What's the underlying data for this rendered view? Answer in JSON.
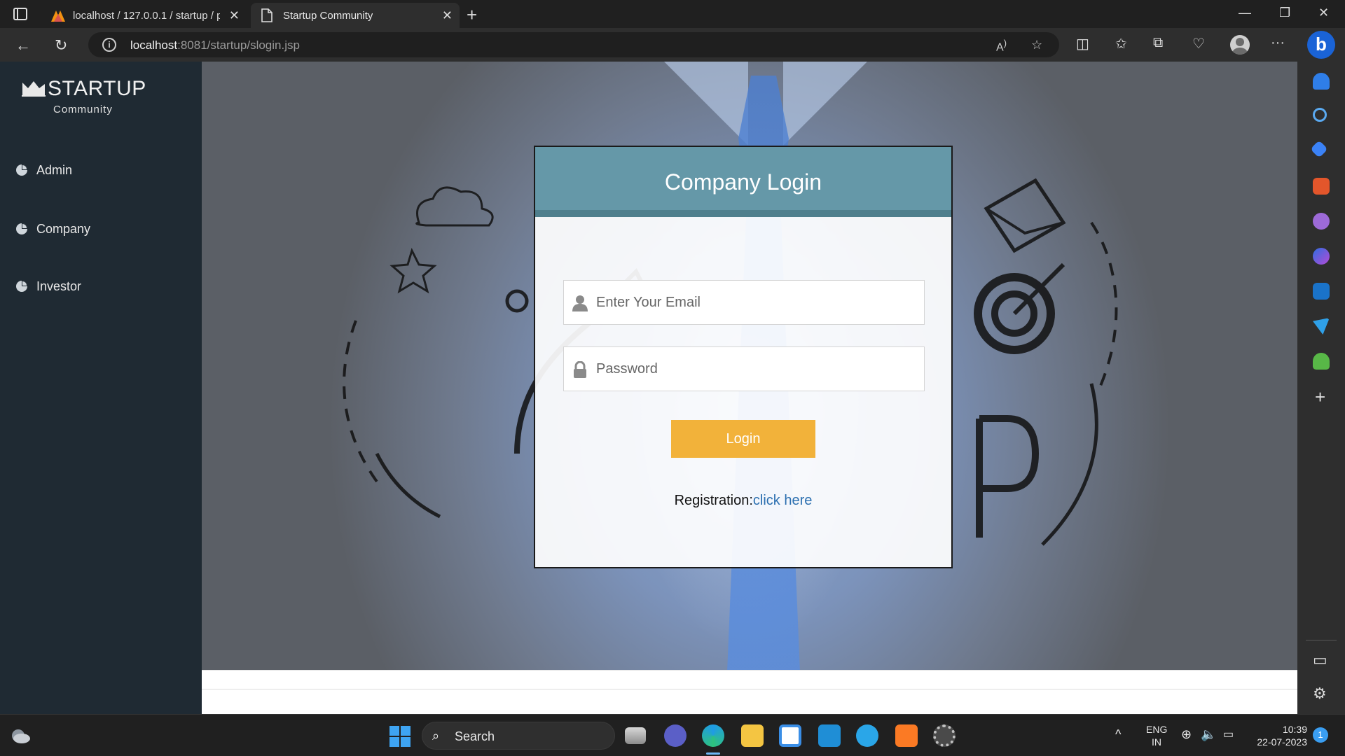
{
  "browser": {
    "tabs": [
      {
        "title": "localhost / 127.0.0.1 / startup / p",
        "active": false
      },
      {
        "title": "Startup Community",
        "active": true
      }
    ],
    "url_host": "localhost",
    "url_rest": ":8081/startup/slogin.jsp"
  },
  "app": {
    "logo_title": "STARTUP",
    "logo_subtitle": "Community",
    "menu": [
      {
        "label": "Admin"
      },
      {
        "label": "Company"
      },
      {
        "label": "Investor"
      }
    ]
  },
  "login": {
    "title": "Company Login",
    "email_placeholder": "Enter Your Email",
    "password_placeholder": "Password",
    "button_label": "Login",
    "registration_label": "Registration:",
    "registration_link": "click here"
  },
  "taskbar": {
    "search_label": "Search",
    "language_line1": "ENG",
    "language_line2": "IN",
    "time": "10:39",
    "date": "22-07-2023",
    "notification_count": "1"
  },
  "colors": {
    "sidebar_bg": "#1f2a33",
    "card_header": "#6598a8",
    "login_button": "#f2b23a",
    "link": "#2b6fb0"
  }
}
